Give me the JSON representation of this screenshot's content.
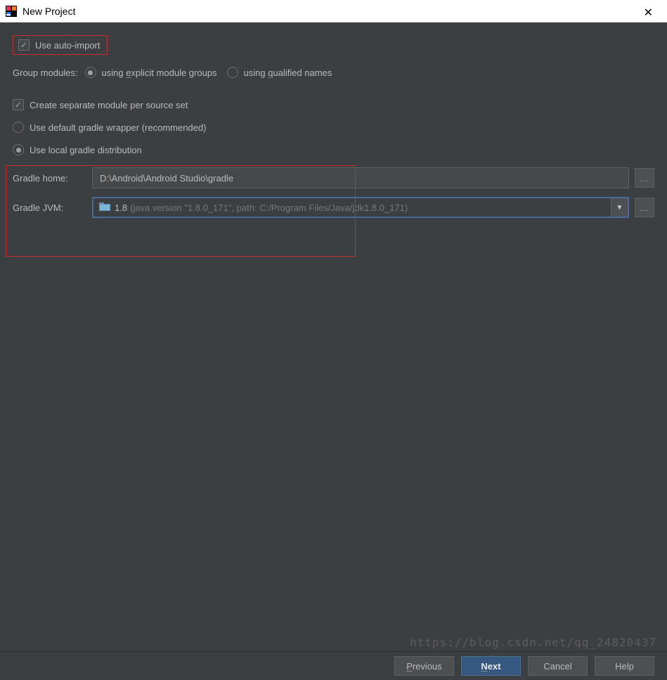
{
  "window": {
    "title": "New Project"
  },
  "options": {
    "auto_import_label": "Use auto-import",
    "group_modules_label": "Group modules:",
    "explicit_groups_label": "using explicit module groups",
    "qualified_names_label": "using qualified names",
    "separate_module_label": "Create separate module per source set",
    "default_wrapper_label": "Use default gradle wrapper (recommended)",
    "local_distribution_label": "Use local gradle distribution"
  },
  "fields": {
    "gradle_home_label": "Gradle home:",
    "gradle_home_value": "D:\\Android\\Android Studio\\gradle",
    "gradle_jvm_label": "Gradle JVM:",
    "gradle_jvm_value": "1.8",
    "gradle_jvm_detail": "(java version \"1.8.0_171\", path: C:/Program Files/Java/jdk1.8.0_171)"
  },
  "buttons": {
    "previous": "Previous",
    "next": "Next",
    "cancel": "Cancel",
    "help": "Help"
  },
  "watermark": "https://blog.csdn.net/qq_24820437"
}
